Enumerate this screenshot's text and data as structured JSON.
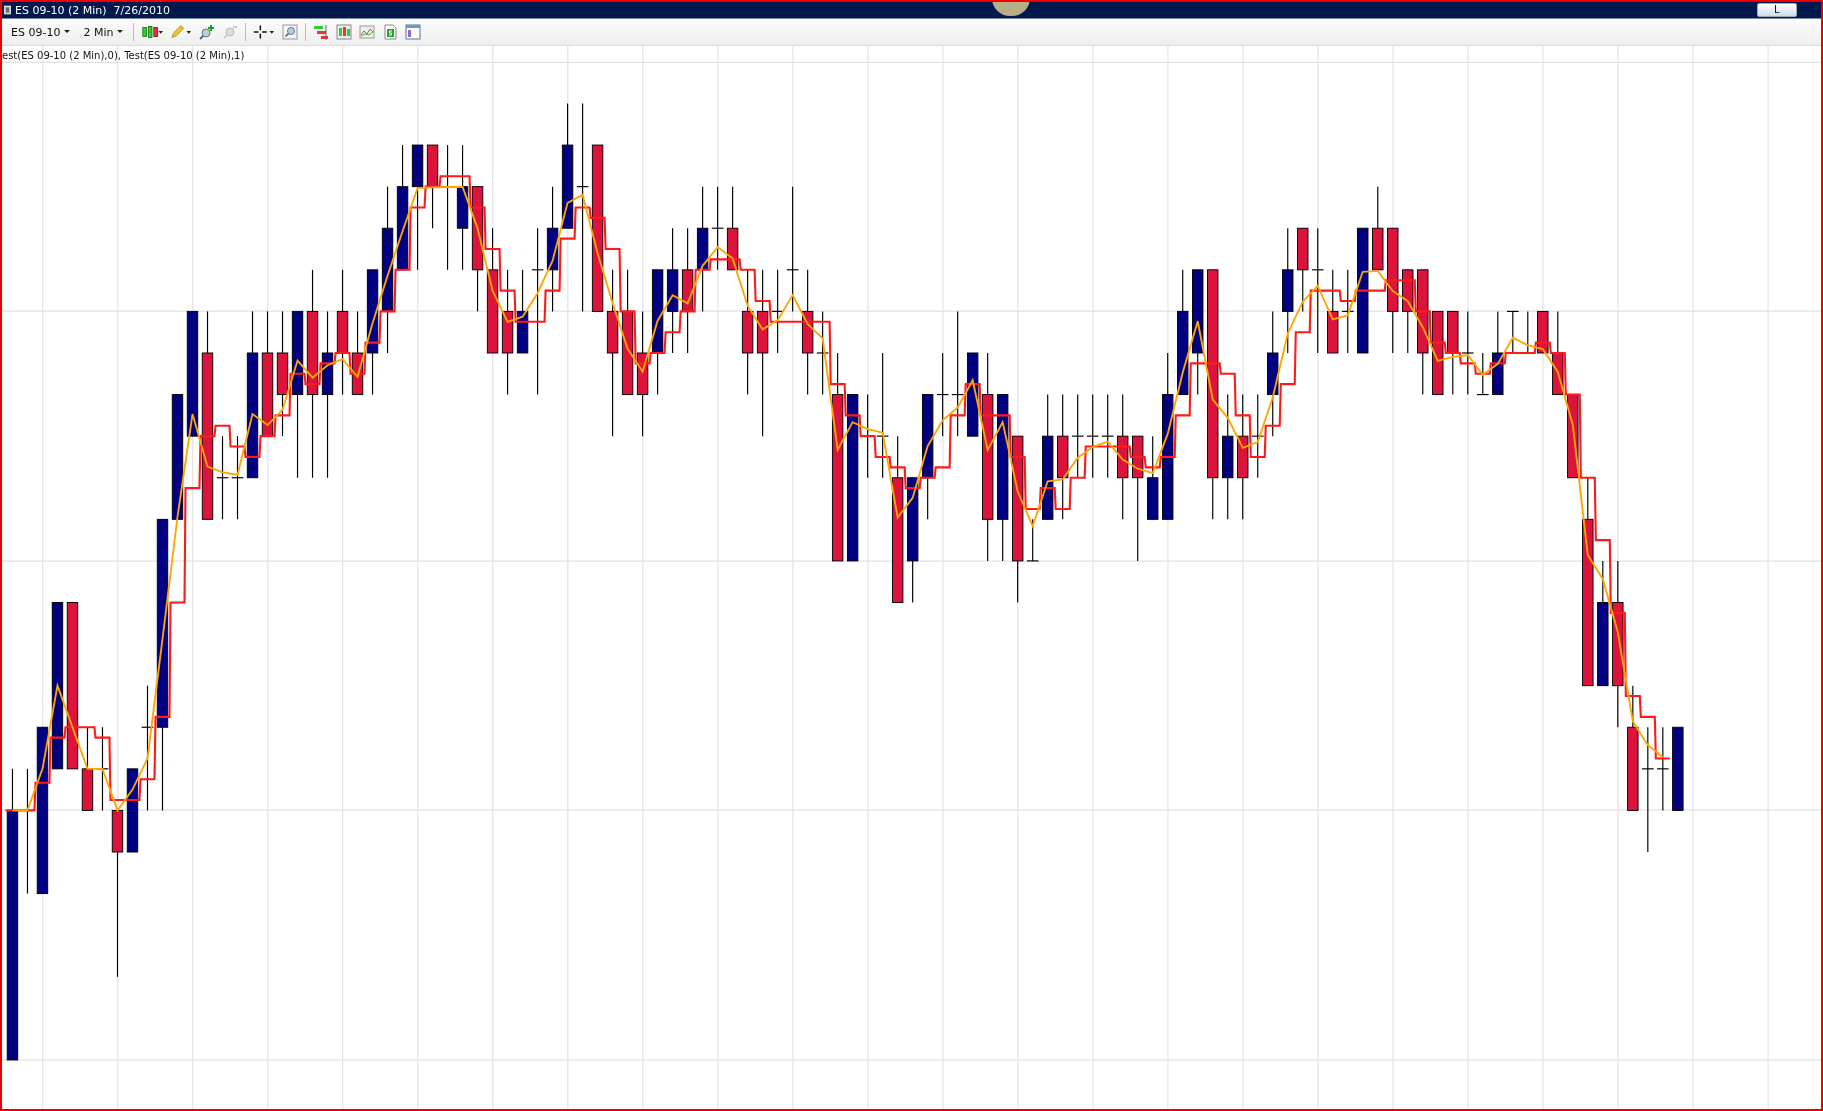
{
  "window": {
    "title": "ES 09-10 (2 Min)  7/26/2010",
    "button": "L"
  },
  "toolbar": {
    "instrument": "ES 09-10",
    "interval": "2 Min"
  },
  "chart": {
    "legend": "est(ES 09-10 (2 Min),0), Test(ES 09-10 (2 Min),1)"
  }
}
